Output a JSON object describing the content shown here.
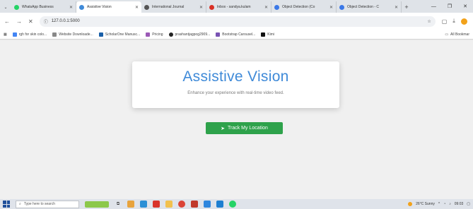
{
  "browser": {
    "tabs": [
      {
        "title": "WhatsApp Business",
        "favicon_color": "#25d366",
        "active": false
      },
      {
        "title": "Assistive Vision",
        "favicon_color": "#3f8ad8",
        "active": true
      },
      {
        "title": "International Journal",
        "favicon_color": "#555555",
        "active": false
      },
      {
        "title": "Inbox - sandya.kulam",
        "favicon_color": "#d93025",
        "active": false
      },
      {
        "title": "Object Detection (Co",
        "favicon_color": "#3b78e7",
        "active": false
      },
      {
        "title": "Object Detection - C",
        "favicon_color": "#3b78e7",
        "active": false
      }
    ],
    "url": "127.0.0.1:5000",
    "bookmarks": [
      {
        "label": "rgh for skin colo...",
        "icon_color": "#4285f4"
      },
      {
        "label": "Website Downloade...",
        "icon_color": "#888888"
      },
      {
        "label": "ScholarOne Manusc...",
        "icon_color": "#1a5fa8"
      },
      {
        "label": "Pricing",
        "icon_color": "#9b59b6"
      },
      {
        "label": "prashantjagpog2909...",
        "icon_color": "#222222"
      },
      {
        "label": "Bootstrap Carousel...",
        "icon_color": "#7952b3"
      },
      {
        "label": "Kimi",
        "icon_color": "#111111"
      }
    ],
    "all_bookmarks_label": "All Bookmar"
  },
  "page": {
    "title": "Assistive Vision",
    "subtitle": "Enhance your experience with real-time video feed.",
    "button_label": "Track My Location",
    "accent": "#3f8ad8",
    "button_color": "#2ea24b"
  },
  "taskbar": {
    "search_placeholder": "Type here to search",
    "weather": "26°C Sunny",
    "time": "09:03"
  }
}
